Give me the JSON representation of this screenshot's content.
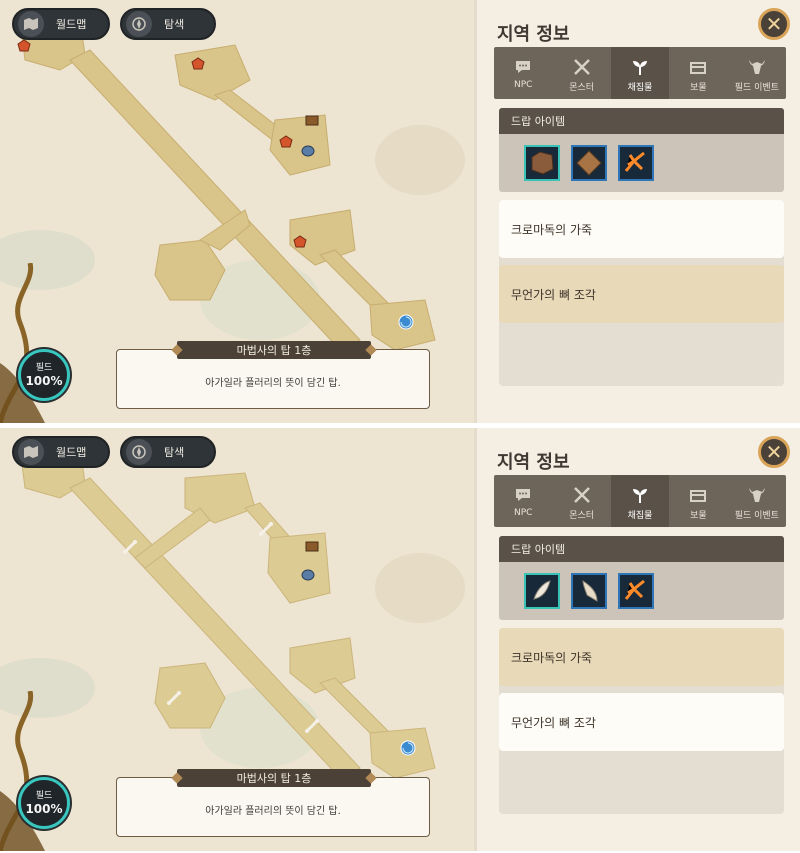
{
  "frames": [
    {
      "map": {
        "btn_worldmap": "월드맵",
        "btn_search": "탐색",
        "field_label": "필드",
        "field_percent": "100%",
        "location_title": "마법사의 탑 1층",
        "location_desc": "아가일라 플러리의 뜻이 담긴 탑.",
        "marker_type": "hide-icon"
      },
      "panel": {
        "title": "지역 정보",
        "tabs": [
          {
            "label": "NPC",
            "icon": "speech-bubble-icon"
          },
          {
            "label": "몬스터",
            "icon": "crossed-swords-icon"
          },
          {
            "label": "채집물",
            "icon": "sprout-icon",
            "active": true
          },
          {
            "label": "보물",
            "icon": "chest-icon"
          },
          {
            "label": "필드 이벤트",
            "icon": "horned-helmet-icon"
          }
        ],
        "drop_header": "드랍 아이템",
        "drop_items": [
          "hide-leather-icon",
          "leather-sheet-icon",
          "bone-fragment-icon"
        ],
        "list": [
          {
            "label": "크로마독의 가죽",
            "style": "light"
          },
          {
            "label": "무언가의 뼈 조각",
            "style": "tan"
          }
        ]
      }
    },
    {
      "map": {
        "btn_worldmap": "월드맵",
        "btn_search": "탐색",
        "field_label": "필드",
        "field_percent": "100%",
        "location_title": "마법사의 탑 1층",
        "location_desc": "아가일라 플러리의 뜻이 담긴 탑.",
        "marker_type": "bone-icon"
      },
      "panel": {
        "title": "지역 정보",
        "tabs": [
          {
            "label": "NPC",
            "icon": "speech-bubble-icon"
          },
          {
            "label": "몬스터",
            "icon": "crossed-swords-icon"
          },
          {
            "label": "채집물",
            "icon": "sprout-icon",
            "active": true
          },
          {
            "label": "보물",
            "icon": "chest-icon"
          },
          {
            "label": "필드 이벤트",
            "icon": "horned-helmet-icon"
          }
        ],
        "drop_header": "드랍 아이템",
        "drop_items": [
          "fang-icon",
          "horn-icon",
          "bone-fragment-icon"
        ],
        "list": [
          {
            "label": "크로마독의 가죽",
            "style": "tan"
          },
          {
            "label": "무언가의 뼈 조각",
            "style": "light"
          }
        ]
      }
    }
  ],
  "colors": {
    "accent_teal": "#39c2b6",
    "panel_bg": "#f5eee3",
    "path_fill": "#d9c48a"
  }
}
